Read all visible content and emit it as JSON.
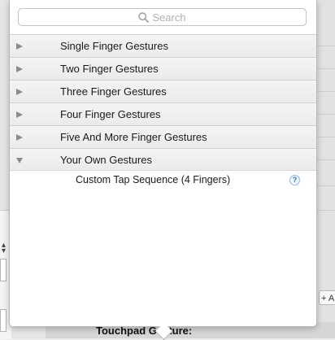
{
  "search": {
    "placeholder": "Search"
  },
  "groups": [
    {
      "label": "Single Finger Gestures",
      "expanded": false
    },
    {
      "label": "Two Finger Gestures",
      "expanded": false
    },
    {
      "label": "Three Finger Gestures",
      "expanded": false
    },
    {
      "label": "Four Finger Gestures",
      "expanded": false
    },
    {
      "label": "Five And More Finger Gestures",
      "expanded": false
    },
    {
      "label": "Your Own Gestures",
      "expanded": true
    }
  ],
  "own_gestures": {
    "items": [
      {
        "label": "Custom Tap Sequence (4 Fingers)",
        "help": "?"
      }
    ]
  },
  "background": {
    "bottom_label": "Touchpad Gesture:",
    "add_button": "+ A"
  },
  "colors": {
    "help_accent": "#2f6fd0",
    "row_background": "#efefef"
  }
}
